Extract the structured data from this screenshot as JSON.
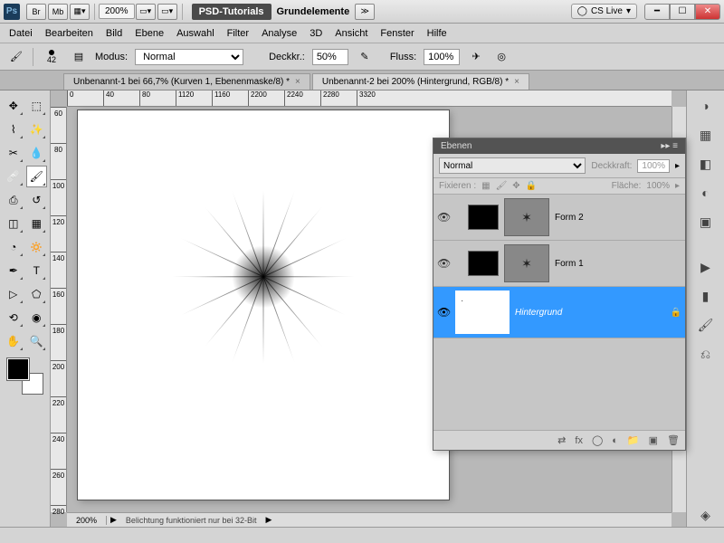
{
  "titlebar": {
    "ps": "Ps",
    "br": "Br",
    "mb": "Mb",
    "zoom": "200%",
    "psd_tutorials": "PSD-Tutorials",
    "grundelemente": "Grundelemente",
    "cslive": "CS Live"
  },
  "menu": [
    "Datei",
    "Bearbeiten",
    "Bild",
    "Ebene",
    "Auswahl",
    "Filter",
    "Analyse",
    "3D",
    "Ansicht",
    "Fenster",
    "Hilfe"
  ],
  "optbar": {
    "brush_size": "42",
    "modus_label": "Modus:",
    "modus_value": "Normal",
    "deckkr_label": "Deckkr.:",
    "deckkr_value": "50%",
    "fluss_label": "Fluss:",
    "fluss_value": "100%"
  },
  "tabs": [
    {
      "label": "Unbenannt-1 bei 66,7% (Kurven 1, Ebenenmaske/8) *",
      "active": false
    },
    {
      "label": "Unbenannt-2 bei 200% (Hintergrund, RGB/8) *",
      "active": true
    }
  ],
  "ruler_h": [
    "0",
    "40",
    "80",
    "120",
    "160",
    "200",
    "240",
    "280",
    "320"
  ],
  "ruler_h_prefix": [
    "",
    "",
    "",
    "1",
    "1",
    "2",
    "2",
    "2",
    "3"
  ],
  "ruler_v": [
    "60",
    "80",
    "100",
    "120",
    "140",
    "160",
    "180",
    "200",
    "220",
    "240",
    "260",
    "280"
  ],
  "status": {
    "zoom": "200%",
    "msg": "Belichtung funktioniert nur bei 32-Bit"
  },
  "layers_panel": {
    "title": "Ebenen",
    "blend": "Normal",
    "opacity_label": "Deckkraft:",
    "opacity_value": "100%",
    "lock_label": "Fixieren :",
    "fill_label": "Fläche:",
    "fill_value": "100%",
    "layers": [
      {
        "name": "Form 2",
        "visible": true,
        "selected": false,
        "mask_glyph": "✶"
      },
      {
        "name": "Form 1",
        "visible": true,
        "selected": false,
        "mask_glyph": "✶"
      },
      {
        "name": "Hintergrund",
        "visible": true,
        "selected": true,
        "locked": true
      }
    ]
  }
}
